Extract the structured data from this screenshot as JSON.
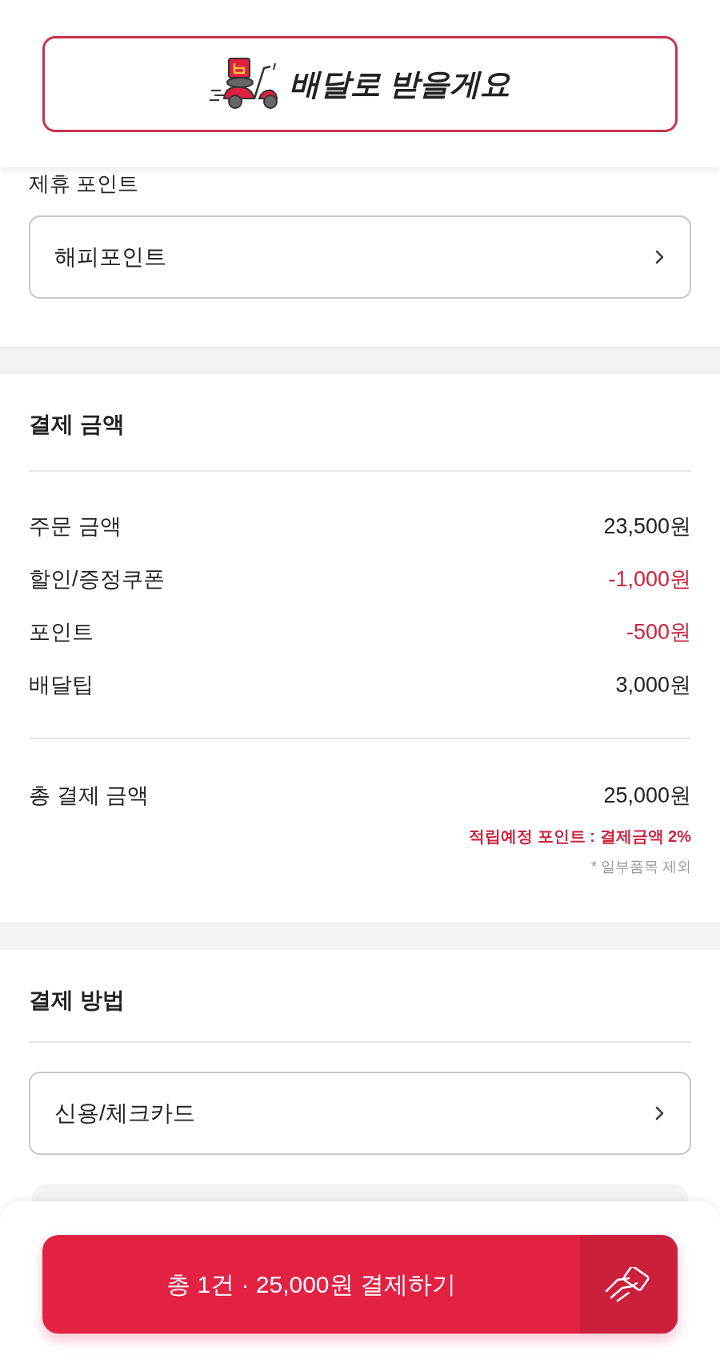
{
  "delivery_button": {
    "label": "배달로 받을게요"
  },
  "partner_points": {
    "label": "제휴 포인트",
    "selector": "해피포인트"
  },
  "payment_amount": {
    "title": "결제 금액",
    "rows": [
      {
        "label": "주문 금액",
        "value": "23,500원",
        "kind": "normal"
      },
      {
        "label": "할인/증정쿠폰",
        "value": "-1,000원",
        "kind": "discount"
      },
      {
        "label": "포인트",
        "value": "-500원",
        "kind": "discount"
      },
      {
        "label": "배달팁",
        "value": "3,000원",
        "kind": "normal"
      }
    ],
    "total_label": "총 결제 금액",
    "total_value": "25,000원",
    "reward_note": "적립예정 포인트 : 결제금액 2%",
    "exclusion_note": "* 일부품목 제외"
  },
  "payment_method": {
    "title": "결제 방법",
    "selector": "신용/체크카드"
  },
  "pay_button": {
    "label": "총 1건 · 25,000원 결제하기"
  }
}
